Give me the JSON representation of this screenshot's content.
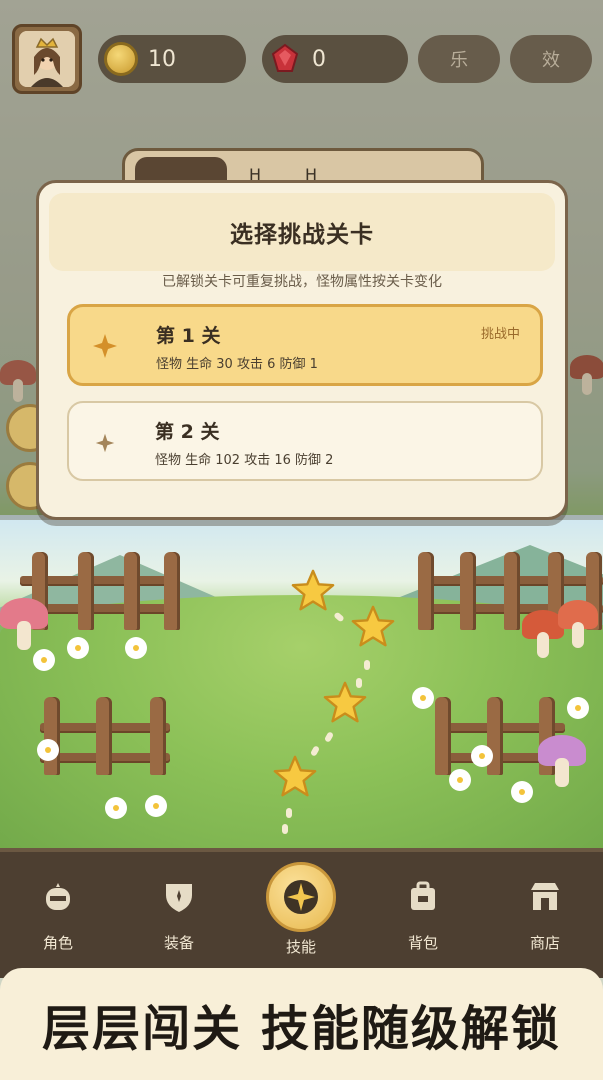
{
  "top_bar": {
    "coins": "10",
    "gems": "0",
    "music_label": "乐",
    "sound_label": "效"
  },
  "modal": {
    "title": "选择挑战关卡",
    "subtitle": "已解锁关卡可重复挑战，怪物属性按关卡变化",
    "levels": [
      {
        "name": "第 1 关",
        "stats": "怪物  生命 30  攻击 6  防御 1",
        "status": "挑战中"
      },
      {
        "name": "第 2 关",
        "stats": "怪物  生命 102  攻击 16  防御 2",
        "status": ""
      }
    ]
  },
  "nav": {
    "items": [
      {
        "label": "角色",
        "icon": "character-icon"
      },
      {
        "label": "装备",
        "icon": "shield-icon"
      },
      {
        "label": "技能",
        "icon": "skill-star-icon"
      },
      {
        "label": "背包",
        "icon": "backpack-icon"
      },
      {
        "label": "商店",
        "icon": "shop-icon"
      }
    ],
    "active_index": 2
  },
  "banner": {
    "text": "层层闯关 技能随级解锁"
  },
  "colors": {
    "accent_gold": "#f8d98a",
    "nav_bg": "#4d3f31",
    "modal_bg": "#f8f1de",
    "gem_red": "#c8323a"
  }
}
